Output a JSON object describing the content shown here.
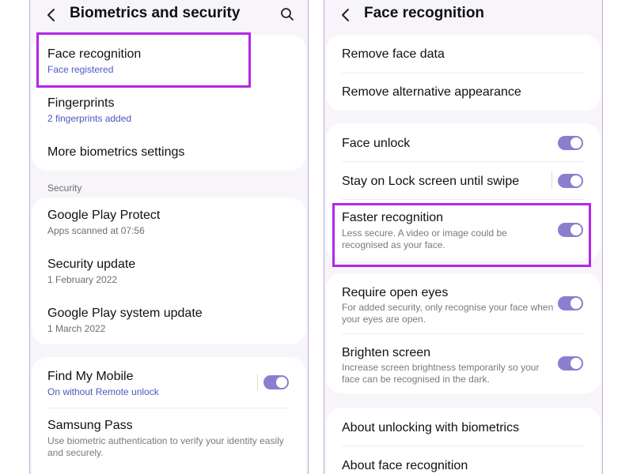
{
  "left": {
    "title": "Biometrics and security",
    "items": {
      "face_recognition": {
        "title": "Face recognition",
        "sub": "Face registered"
      },
      "fingerprints": {
        "title": "Fingerprints",
        "sub": "2 fingerprints added"
      },
      "more_biometrics": {
        "title": "More biometrics settings"
      }
    },
    "security_section": "Security",
    "security_items": {
      "play_protect": {
        "title": "Google Play Protect",
        "sub": "Apps scanned at 07:56"
      },
      "security_update": {
        "title": "Security update",
        "sub": "1 February 2022"
      },
      "play_system_update": {
        "title": "Google Play system update",
        "sub": "1 March 2022"
      }
    },
    "bottom_items": {
      "find_my_mobile": {
        "title": "Find My Mobile",
        "sub": "On without Remote unlock",
        "toggle_on": true
      },
      "samsung_pass": {
        "title": "Samsung Pass",
        "sub": "Use biometric authentication to verify your identity easily and securely."
      }
    }
  },
  "right": {
    "title": "Face recognition",
    "items": {
      "remove_face_data": {
        "title": "Remove face data"
      },
      "remove_alt": {
        "title": "Remove alternative appearance"
      },
      "face_unlock": {
        "title": "Face unlock",
        "toggle_on": true
      },
      "stay_on_lock": {
        "title": "Stay on Lock screen until swipe",
        "toggle_on": true
      },
      "faster_recognition": {
        "title": "Faster recognition",
        "sub": "Less secure. A video or image could be recognised as your face.",
        "toggle_on": true
      },
      "require_open_eyes": {
        "title": "Require open eyes",
        "sub": "For added security, only recognise your face when your eyes are open.",
        "toggle_on": true
      },
      "brighten_screen": {
        "title": "Brighten screen",
        "sub": "Increase screen brightness temporarily so your face can be recognised in the dark.",
        "toggle_on": true
      },
      "about_unlocking": {
        "title": "About unlocking with biometrics"
      },
      "about_face": {
        "title": "About face recognition"
      }
    }
  },
  "colors": {
    "toggle_on": "#8a7fcf",
    "highlight": "#b427e6",
    "link_blue": "#4a58c0",
    "card": "#ffffff",
    "screen_bg": "#f7f5f9"
  },
  "icons": [
    "back-arrow-icon",
    "search-icon"
  ]
}
